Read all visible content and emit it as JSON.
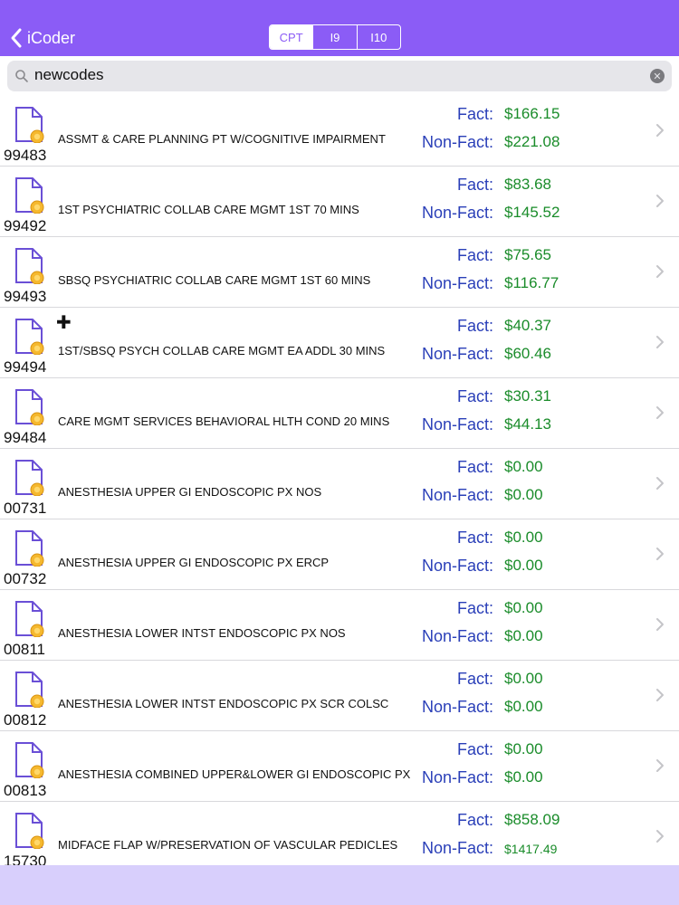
{
  "navbar": {
    "back_label": "iCoder",
    "segments": [
      "CPT",
      "I9",
      "I10"
    ],
    "selected_segment": "CPT",
    "accent_color": "#8b5cf6"
  },
  "search": {
    "value": "newcodes"
  },
  "fact_label": "Fact:",
  "nonfact_label": "Non-Fact:",
  "rows": [
    {
      "code": "99483",
      "desc": "ASSMT & CARE PLANNING PT W/COGNITIVE IMPAIRMENT",
      "fact": "$166.15",
      "nonfact": "$221.08",
      "addon": false
    },
    {
      "code": "99492",
      "desc": "1ST PSYCHIATRIC COLLAB CARE MGMT 1ST 70 MINS",
      "fact": "$83.68",
      "nonfact": "$145.52",
      "addon": false
    },
    {
      "code": "99493",
      "desc": "SBSQ PSYCHIATRIC COLLAB CARE MGMT 1ST 60 MINS",
      "fact": "$75.65",
      "nonfact": "$116.77",
      "addon": false
    },
    {
      "code": "99494",
      "desc": "1ST/SBSQ PSYCH COLLAB CARE MGMT EA ADDL 30 MINS",
      "fact": "$40.37",
      "nonfact": "$60.46",
      "addon": true
    },
    {
      "code": "99484",
      "desc": "CARE MGMT SERVICES BEHAVIORAL HLTH COND 20 MINS",
      "fact": "$30.31",
      "nonfact": "$44.13",
      "addon": false
    },
    {
      "code": "00731",
      "desc": "ANESTHESIA UPPER GI ENDOSCOPIC PX NOS",
      "fact": "$0.00",
      "nonfact": "$0.00",
      "addon": false
    },
    {
      "code": "00732",
      "desc": "ANESTHESIA UPPER GI ENDOSCOPIC PX ERCP",
      "fact": "$0.00",
      "nonfact": "$0.00",
      "addon": false
    },
    {
      "code": "00811",
      "desc": "ANESTHESIA LOWER INTST ENDOSCOPIC PX NOS",
      "fact": "$0.00",
      "nonfact": "$0.00",
      "addon": false
    },
    {
      "code": "00812",
      "desc": "ANESTHESIA LOWER INTST ENDOSCOPIC PX SCR COLSC",
      "fact": "$0.00",
      "nonfact": "$0.00",
      "addon": false
    },
    {
      "code": "00813",
      "desc": "ANESTHESIA COMBINED UPPER&LOWER GI ENDOSCOPIC PX",
      "fact": "$0.00",
      "nonfact": "$0.00",
      "addon": false
    },
    {
      "code": "15730",
      "desc": "MIDFACE FLAP W/PRESERVATION OF VASCULAR PEDICLES",
      "fact": "$858.09",
      "nonfact": "$1417.49",
      "addon": false
    }
  ]
}
